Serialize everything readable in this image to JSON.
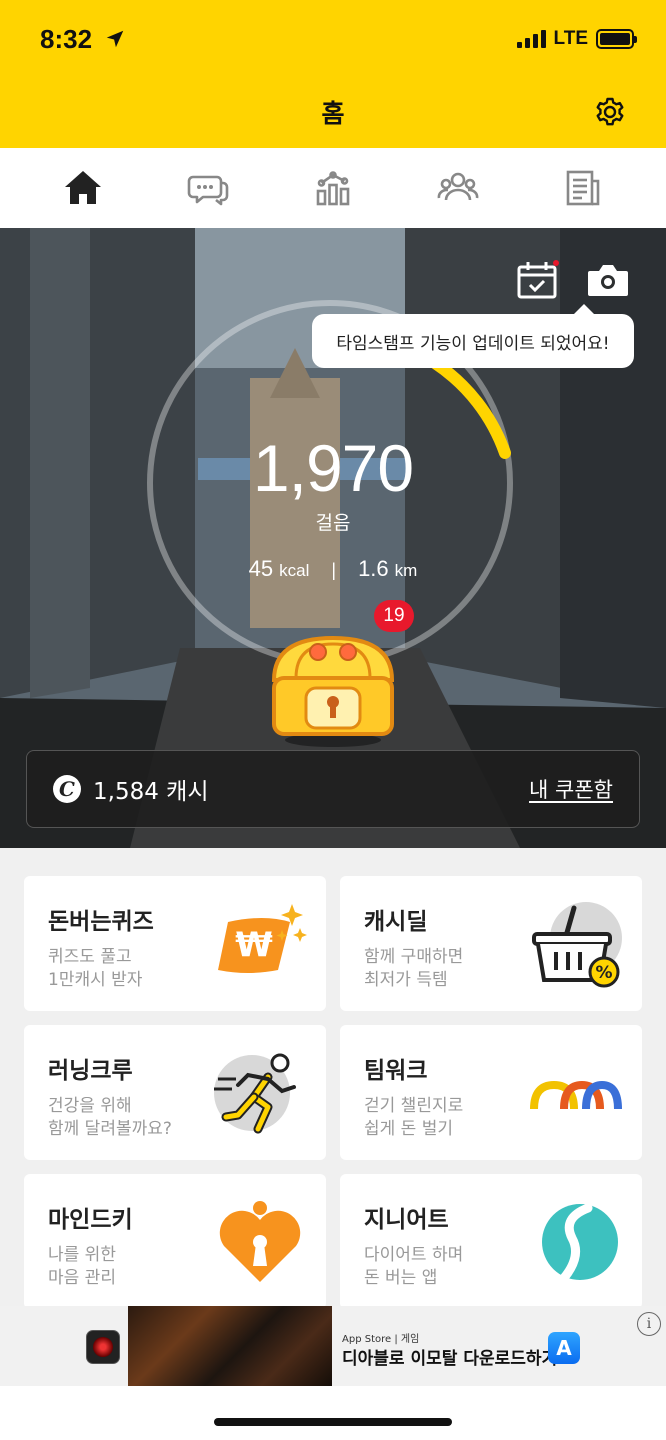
{
  "status_bar": {
    "time": "8:32",
    "network": "LTE",
    "signal_bars": 4,
    "battery_level": 0.9
  },
  "header": {
    "title": "홈"
  },
  "nav": {
    "items": [
      "home-icon",
      "chat-icon",
      "stats-icon",
      "friends-icon",
      "news-icon"
    ],
    "active": "home-icon"
  },
  "hero": {
    "tooltip": "타임스탬프 기능이 업데이트 되었어요!",
    "steps": "1,970",
    "steps_unit": "걸음",
    "kcal": "45",
    "kcal_unit": "kcal",
    "distance": "1.6",
    "distance_unit": "km",
    "separator": "|",
    "badge": "19",
    "cash_icon": "C",
    "cash": "1,584 캐시",
    "coupon_link": "내 쿠폰함"
  },
  "cards": [
    {
      "title": "돈버는퀴즈",
      "desc": "퀴즈도 풀고\n1만캐시 받자",
      "icon": "won-sparkle-icon"
    },
    {
      "title": "캐시딜",
      "desc": "함께 구매하면\n최저가 득템",
      "icon": "basket-icon"
    },
    {
      "title": "러닝크루",
      "desc": "건강을 위해\n함께 달려볼까요?",
      "icon": "runner-icon"
    },
    {
      "title": "팀워크",
      "desc": "걷기 챌린지로\n쉽게 돈 벌기",
      "icon": "teamwork-icon"
    },
    {
      "title": "마인드키",
      "desc": "나를 위한\n마음 관리",
      "icon": "heart-keyhole-icon"
    },
    {
      "title": "지니어트",
      "desc": "다이어트 하며\n돈 버는 앱",
      "icon": "geniet-logo-icon"
    }
  ],
  "ad": {
    "small": "App Store | 게임",
    "text": "디아블로 이모탈 다운로드하기",
    "info": "i",
    "store_glyph": "A"
  },
  "colors": {
    "brand_yellow": "#ffd400",
    "orange": "#f7931e",
    "badge_red": "#e8192c"
  }
}
